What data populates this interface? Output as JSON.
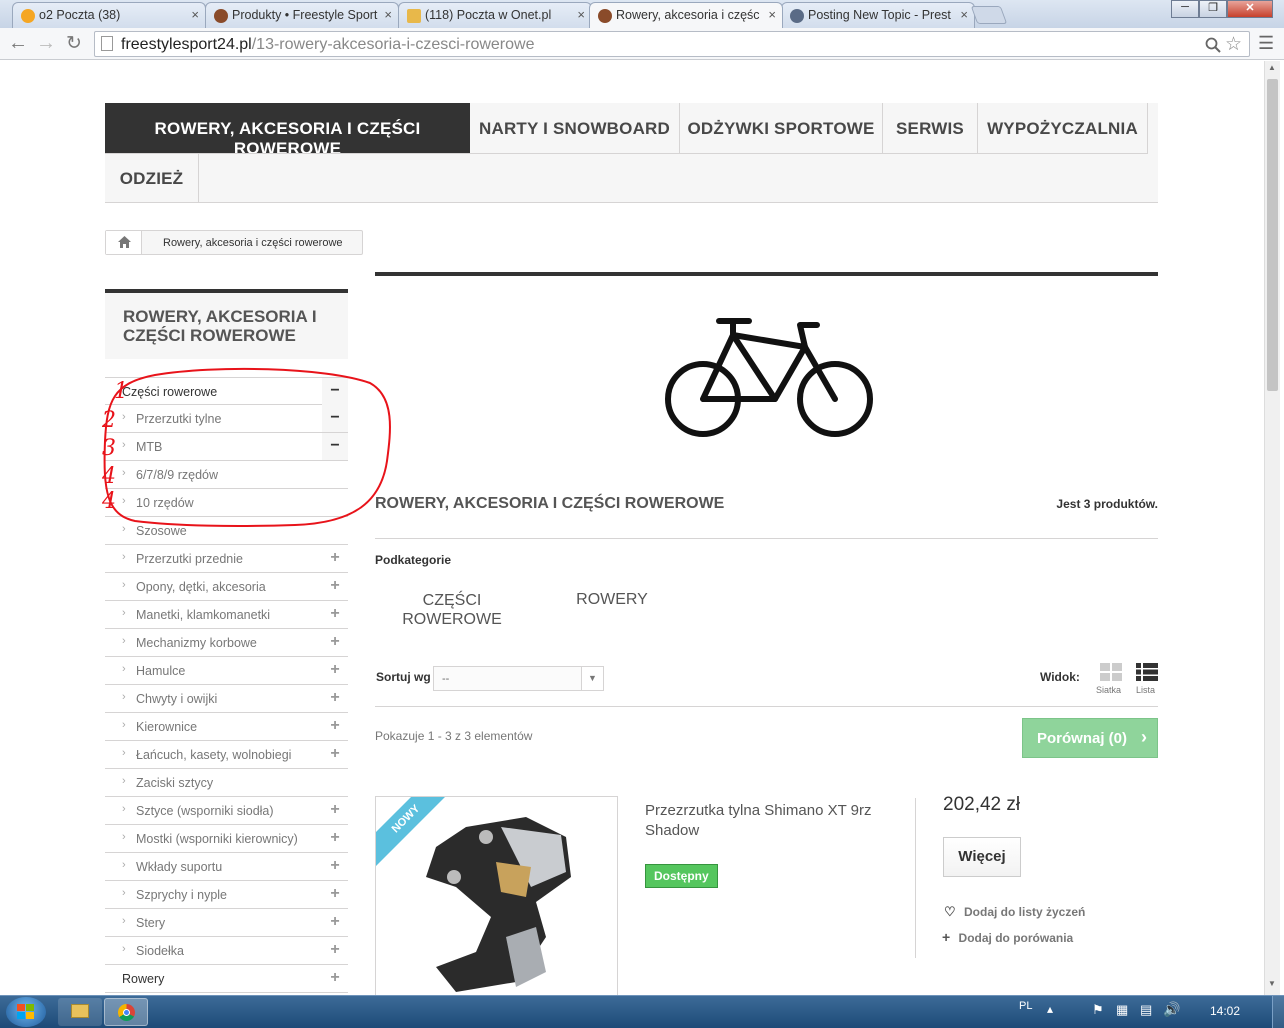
{
  "browser": {
    "tabs": [
      {
        "title": "o2 Poczta (38)",
        "close": "×"
      },
      {
        "title": "Produkty • Freestyle Sport",
        "close": "×"
      },
      {
        "title": "(118) Poczta w Onet.pl",
        "close": "×"
      },
      {
        "title": "Rowery, akcesoria i częśc",
        "close": "×"
      },
      {
        "title": "Posting New Topic - Prest",
        "close": "×"
      }
    ],
    "url_domain": "freestylesport24.pl",
    "url_path": "/13-rowery-akcesoria-i-czesci-rowerowe"
  },
  "menu": [
    "ROWERY, AKCESORIA I CZĘŚCI ROWEROWE",
    "NARTY I SNOWBOARD",
    "ODŻYWKI SPORTOWE",
    "SERWIS",
    "WYPOŻYCZALNIA",
    "ODZIEŻ"
  ],
  "breadcrumb": {
    "current": "Rowery, akcesoria i części rowerowe"
  },
  "sidebar": {
    "title": "ROWERY, AKCESORIA I CZĘŚCI ROWEROWE",
    "items": [
      {
        "label": "Części rowerowe",
        "toggle": "−"
      },
      {
        "label": "Przerzutki tylne",
        "toggle": "−"
      },
      {
        "label": "MTB",
        "toggle": "−"
      },
      {
        "label": "6/7/8/9 rzędów",
        "toggle": ""
      },
      {
        "label": "10 rzędów",
        "toggle": ""
      },
      {
        "label": "Szosowe",
        "toggle": ""
      },
      {
        "label": "Przerzutki przednie",
        "toggle": "+"
      },
      {
        "label": "Opony, dętki, akcesoria",
        "toggle": "+"
      },
      {
        "label": "Manetki, klamkomanetki",
        "toggle": "+"
      },
      {
        "label": "Mechanizmy korbowe",
        "toggle": "+"
      },
      {
        "label": "Hamulce",
        "toggle": "+"
      },
      {
        "label": "Chwyty i owijki",
        "toggle": "+"
      },
      {
        "label": "Kierownice",
        "toggle": "+"
      },
      {
        "label": "Łańcuch, kasety, wolnobiegi",
        "toggle": "+"
      },
      {
        "label": "Zaciski sztycy",
        "toggle": ""
      },
      {
        "label": "Sztyce (wsporniki siodła)",
        "toggle": "+"
      },
      {
        "label": "Mostki (wsporniki kierownicy)",
        "toggle": "+"
      },
      {
        "label": "Wkłady suportu",
        "toggle": "+"
      },
      {
        "label": "Szprychy i nyple",
        "toggle": "+"
      },
      {
        "label": "Stery",
        "toggle": "+"
      },
      {
        "label": "Siodełka",
        "toggle": "+"
      },
      {
        "label": "Rowery",
        "toggle": "+"
      }
    ],
    "annotations": [
      "1",
      "2",
      "3",
      "4",
      "4"
    ]
  },
  "category": {
    "title": "ROWERY, AKCESORIA I CZĘŚCI ROWEROWE",
    "count": "Jest 3 produktów.",
    "subcategories_label": "Podkategorie",
    "subcategories": [
      "CZĘŚCI ROWEROWE",
      "ROWERY"
    ]
  },
  "controls": {
    "sort_label": "Sortuj wg",
    "sort_value": "--",
    "view_label": "Widok:",
    "view_grid": "Siatka",
    "view_list": "Lista",
    "showing": "Pokazuje 1 - 3 z 3 elementów",
    "compare": "Porównaj (0)"
  },
  "product": {
    "badge": "NOWY",
    "name": "Przezrzutka tylna Shimano XT 9rz Shadow",
    "availability": "Dostępny",
    "price": "202,42 zł",
    "more": "Więcej",
    "wishlist": "Dodaj do listy życzeń",
    "compare": "Dodaj do porówania"
  },
  "taskbar": {
    "lang": "PL",
    "time": "14:02"
  },
  "colors": {
    "dark": "#333333",
    "green": "#55c65e",
    "compare": "#8fd49b",
    "annotation": "#e8131a"
  }
}
